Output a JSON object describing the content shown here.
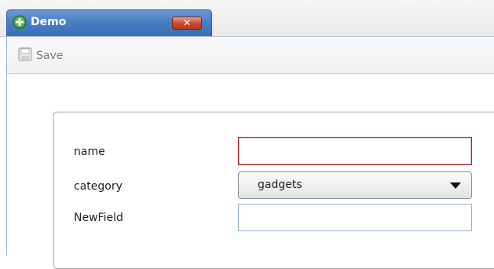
{
  "window": {
    "tab_title": "Demo",
    "close_icon": "close-icon",
    "tab_icon": "add-circle-icon"
  },
  "toolbar": {
    "save_label": "Save",
    "save_icon": "floppy-disk-icon"
  },
  "form": {
    "name_label": "name",
    "name_value": "",
    "category_label": "category",
    "category_value": "gadgets",
    "newfield_label": "NewField",
    "newfield_value": ""
  },
  "colors": {
    "tab_blue": "#4a7fc4",
    "close_red": "#c8462c",
    "invalid_border": "#b22222"
  }
}
